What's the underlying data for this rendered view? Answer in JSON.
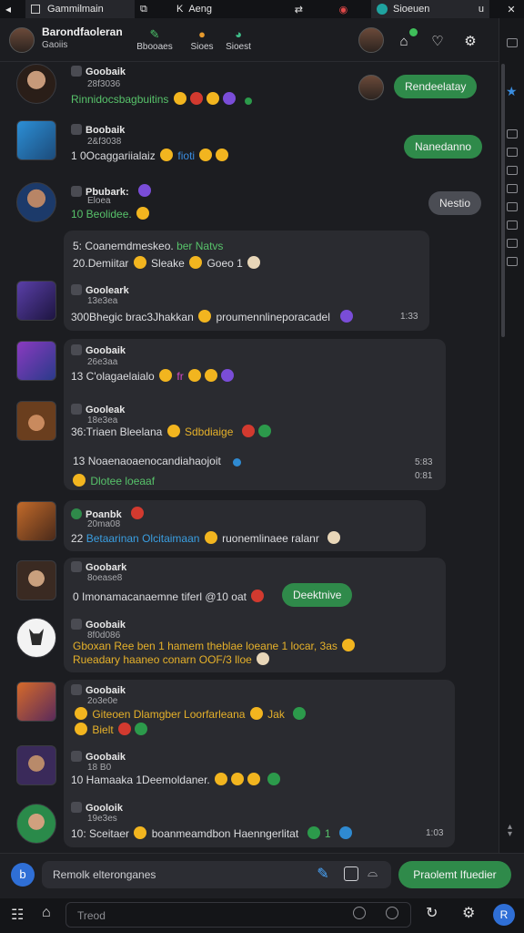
{
  "topbar": {
    "tab1": "Gammilmain",
    "tab2": "Aeng",
    "tab3": "Sioeuen"
  },
  "header": {
    "title": "Barondfaoleran",
    "subtitle": "Gaoiis",
    "tabs": [
      {
        "label": "Bbooaes",
        "icon": "pen-icon"
      },
      {
        "label": "Sioes",
        "icon": "coin-icon"
      },
      {
        "label": "Sioest",
        "icon": "chat-icon"
      }
    ],
    "notif_badge": "•"
  },
  "messages": [
    {
      "name": "Goobaik",
      "time": "28f3036",
      "text": "Rinnidocsbagbuitins",
      "right_bubble": "Rendeelatay"
    },
    {
      "name": "Boobaik",
      "time": "2&f3038",
      "text": "1 0Ocaggariialaiz",
      "tag": "fioti",
      "right_bubble": "Nanedanno"
    },
    {
      "name": "Pbubark:",
      "time": "Eloea",
      "text": "10 Beolidee.",
      "right_bubble": "Nestio"
    },
    {
      "name": "",
      "time": "",
      "text": "Coanemdmeskeo.",
      "tag": "ber Natvs",
      "text2": "Demiitar",
      "text2b": "Sleake",
      "text2c": "Goeo 1"
    },
    {
      "name": "Gooleark",
      "time": "13e3ea",
      "text": "300Bhegic brac3Jhakkan",
      "text2": "proumennlineporacadel",
      "time_right": "1:33"
    },
    {
      "name": "Goobaik",
      "time": "26e3aa",
      "text": "13 C'olagaelaialo",
      "tag": "fr"
    },
    {
      "name": "Gooleak",
      "time": "18e3ea",
      "text": "36:Triaen Bleelana",
      "tag": "Sdbdiaige"
    },
    {
      "name": "",
      "time": "",
      "text": "Noaenaoaenocandiahaojoit",
      "text2": "Dlotee loeaaf",
      "time_right": "5:83",
      "time_right2": "0:81"
    },
    {
      "name": "Poanbk",
      "time": "20ma08",
      "text": "Betaarinan Olcitaimaan",
      "text2": "ruonemlinaee ralanr"
    },
    {
      "name": "Goobark",
      "time": "8oease8",
      "text": "0 Imonamacanaemne tiferl @10 oat",
      "right_bubble": "Deektnive"
    },
    {
      "name": "Goobaik",
      "time": "8f0d086",
      "text": "Gboxan Ree ben 1 hamem theblae loeane 1 locar, 3as",
      "text2": "Rueadary haaneo conarn OOF/3 lloe"
    },
    {
      "name": "Goobaik",
      "time": "2o3e0e",
      "text": "Giteoen Dlamgber Loorfarleana",
      "tag": "Jak",
      "text2": "Bielt"
    },
    {
      "name": "Goobaik",
      "time": "18 B0",
      "text": "10 Hamaaka 1Deemoldaner."
    },
    {
      "name": "Gooloik",
      "time": "19e3es",
      "text": "10: Sceitaer",
      "text2": "boanmeamdbon Haenngerlitat",
      "time_right": "1:03"
    }
  ],
  "composer": {
    "placeholder": "Remolk elteronganes",
    "send_label": "Praolemt Ifuedier"
  },
  "bottombar": {
    "search_placeholder": "Treod"
  },
  "colors": {
    "accent": "#2f8a4a",
    "background": "#1c1d21",
    "card": "#2a2b30"
  }
}
